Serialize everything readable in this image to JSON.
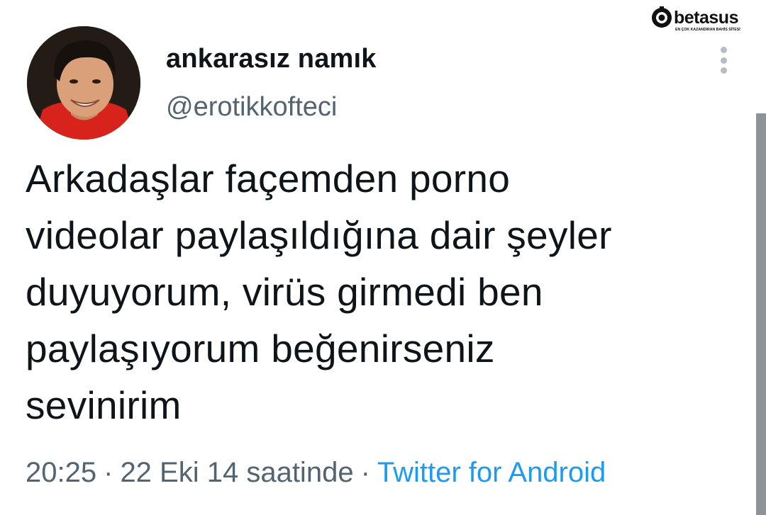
{
  "watermark": {
    "brand": "betasus",
    "tagline": "EN ÇOK KAZANDIRAN BAHİS SİTESİ"
  },
  "tweet": {
    "author": {
      "display_name": "ankarasız namık",
      "handle": "@erotikkofteci"
    },
    "text_lines": [
      "Arkadaşlar façemden porno",
      "videolar paylaşıldığına dair şeyler",
      "duyuyorum, virüs girmedi ben",
      "paylaşıyorum beğenirseniz",
      "sevinirim"
    ],
    "meta": {
      "time": "20:25",
      "separator": "·",
      "date": "22 Eki 14 saatinde",
      "source": "Twitter for Android"
    }
  },
  "colors": {
    "text": "#0f1419",
    "secondary": "#536471",
    "link": "#1d9bf0"
  },
  "icons": {
    "more": "more-vertical-icon",
    "watermark": "betasus-logo-icon"
  }
}
